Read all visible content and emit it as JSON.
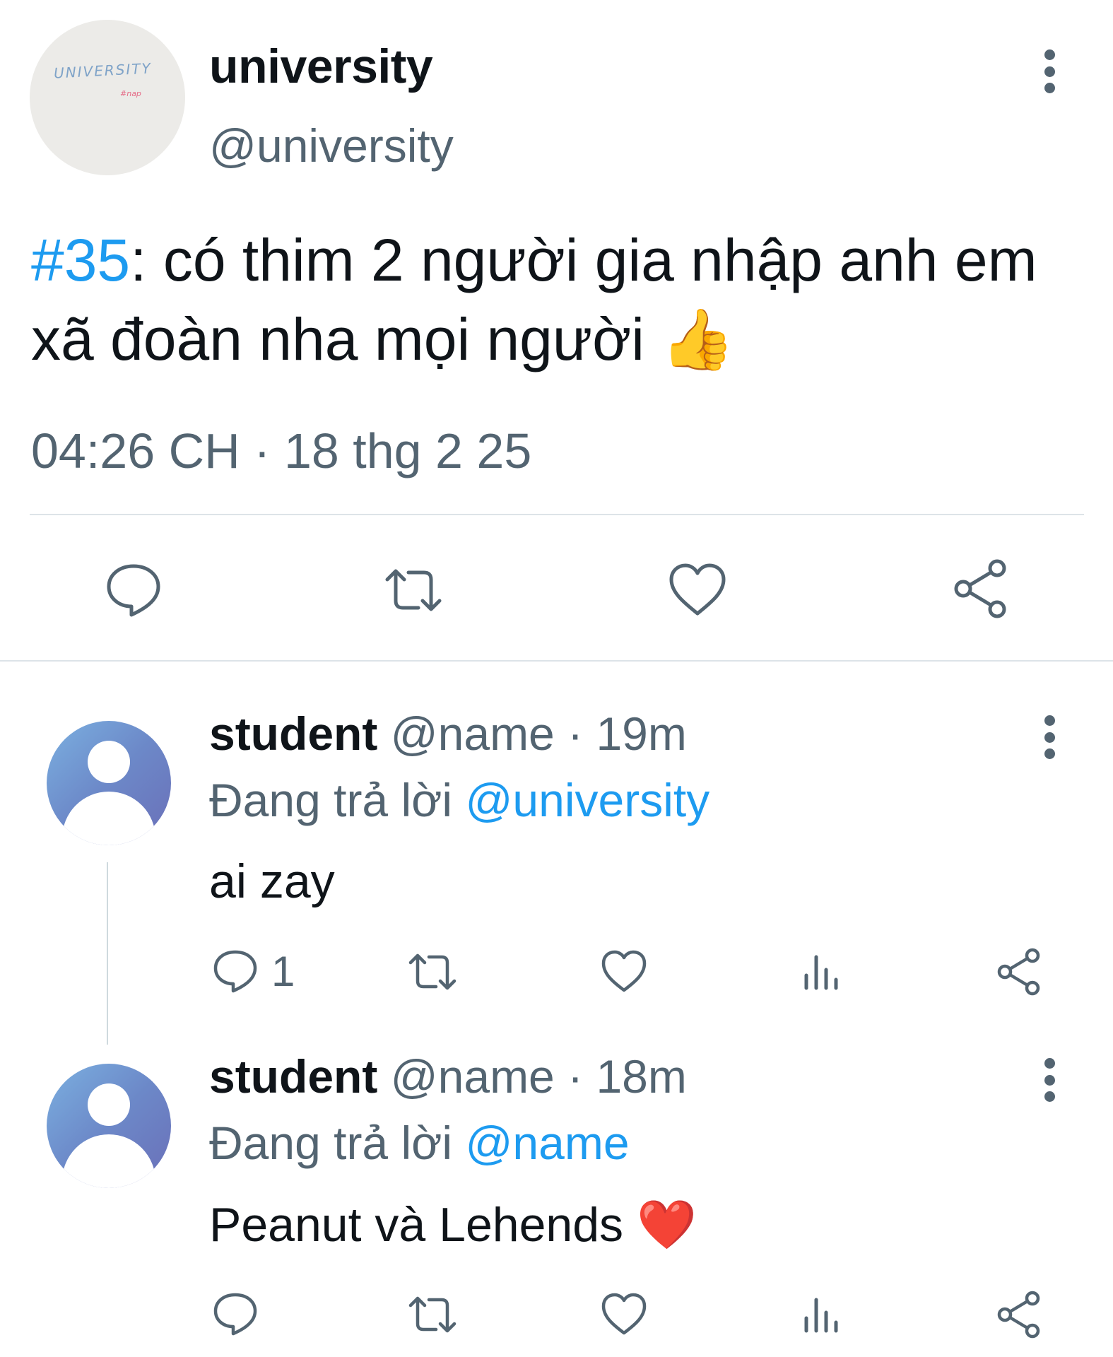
{
  "tweet": {
    "avatar": {
      "logo_text": "UNIVERSITY",
      "logo_sub": "#nap"
    },
    "display_name": "university",
    "handle": "@university",
    "hashtag": "#35",
    "text": ": có thim 2 người gia nhập anh em xã đoàn nha mọi người",
    "emoji": "👍",
    "time": "04:26 CH",
    "date": "18 thg 2 25",
    "meta_separator": "·"
  },
  "replies": [
    {
      "display_name": "student",
      "handle": "@name",
      "age": "19m",
      "replying_label": "Đang trả lời",
      "replying_to": "@university",
      "text": "ai zay",
      "reply_count": "1"
    },
    {
      "display_name": "student",
      "handle": "@name",
      "age": "18m",
      "replying_label": "Đang trả lời",
      "replying_to": "@name",
      "text": "Peanut và Lehends",
      "emoji": "❤️"
    }
  ],
  "icons": {
    "reply": "comment-icon",
    "retweet": "retweet-icon",
    "like": "heart-icon",
    "share": "share-icon",
    "views": "analytics-icon",
    "more": "more-vertical-icon"
  },
  "colors": {
    "accent": "#1d9bf0",
    "text": "#0f1419",
    "muted": "#536471",
    "divider": "#dde3e8"
  }
}
